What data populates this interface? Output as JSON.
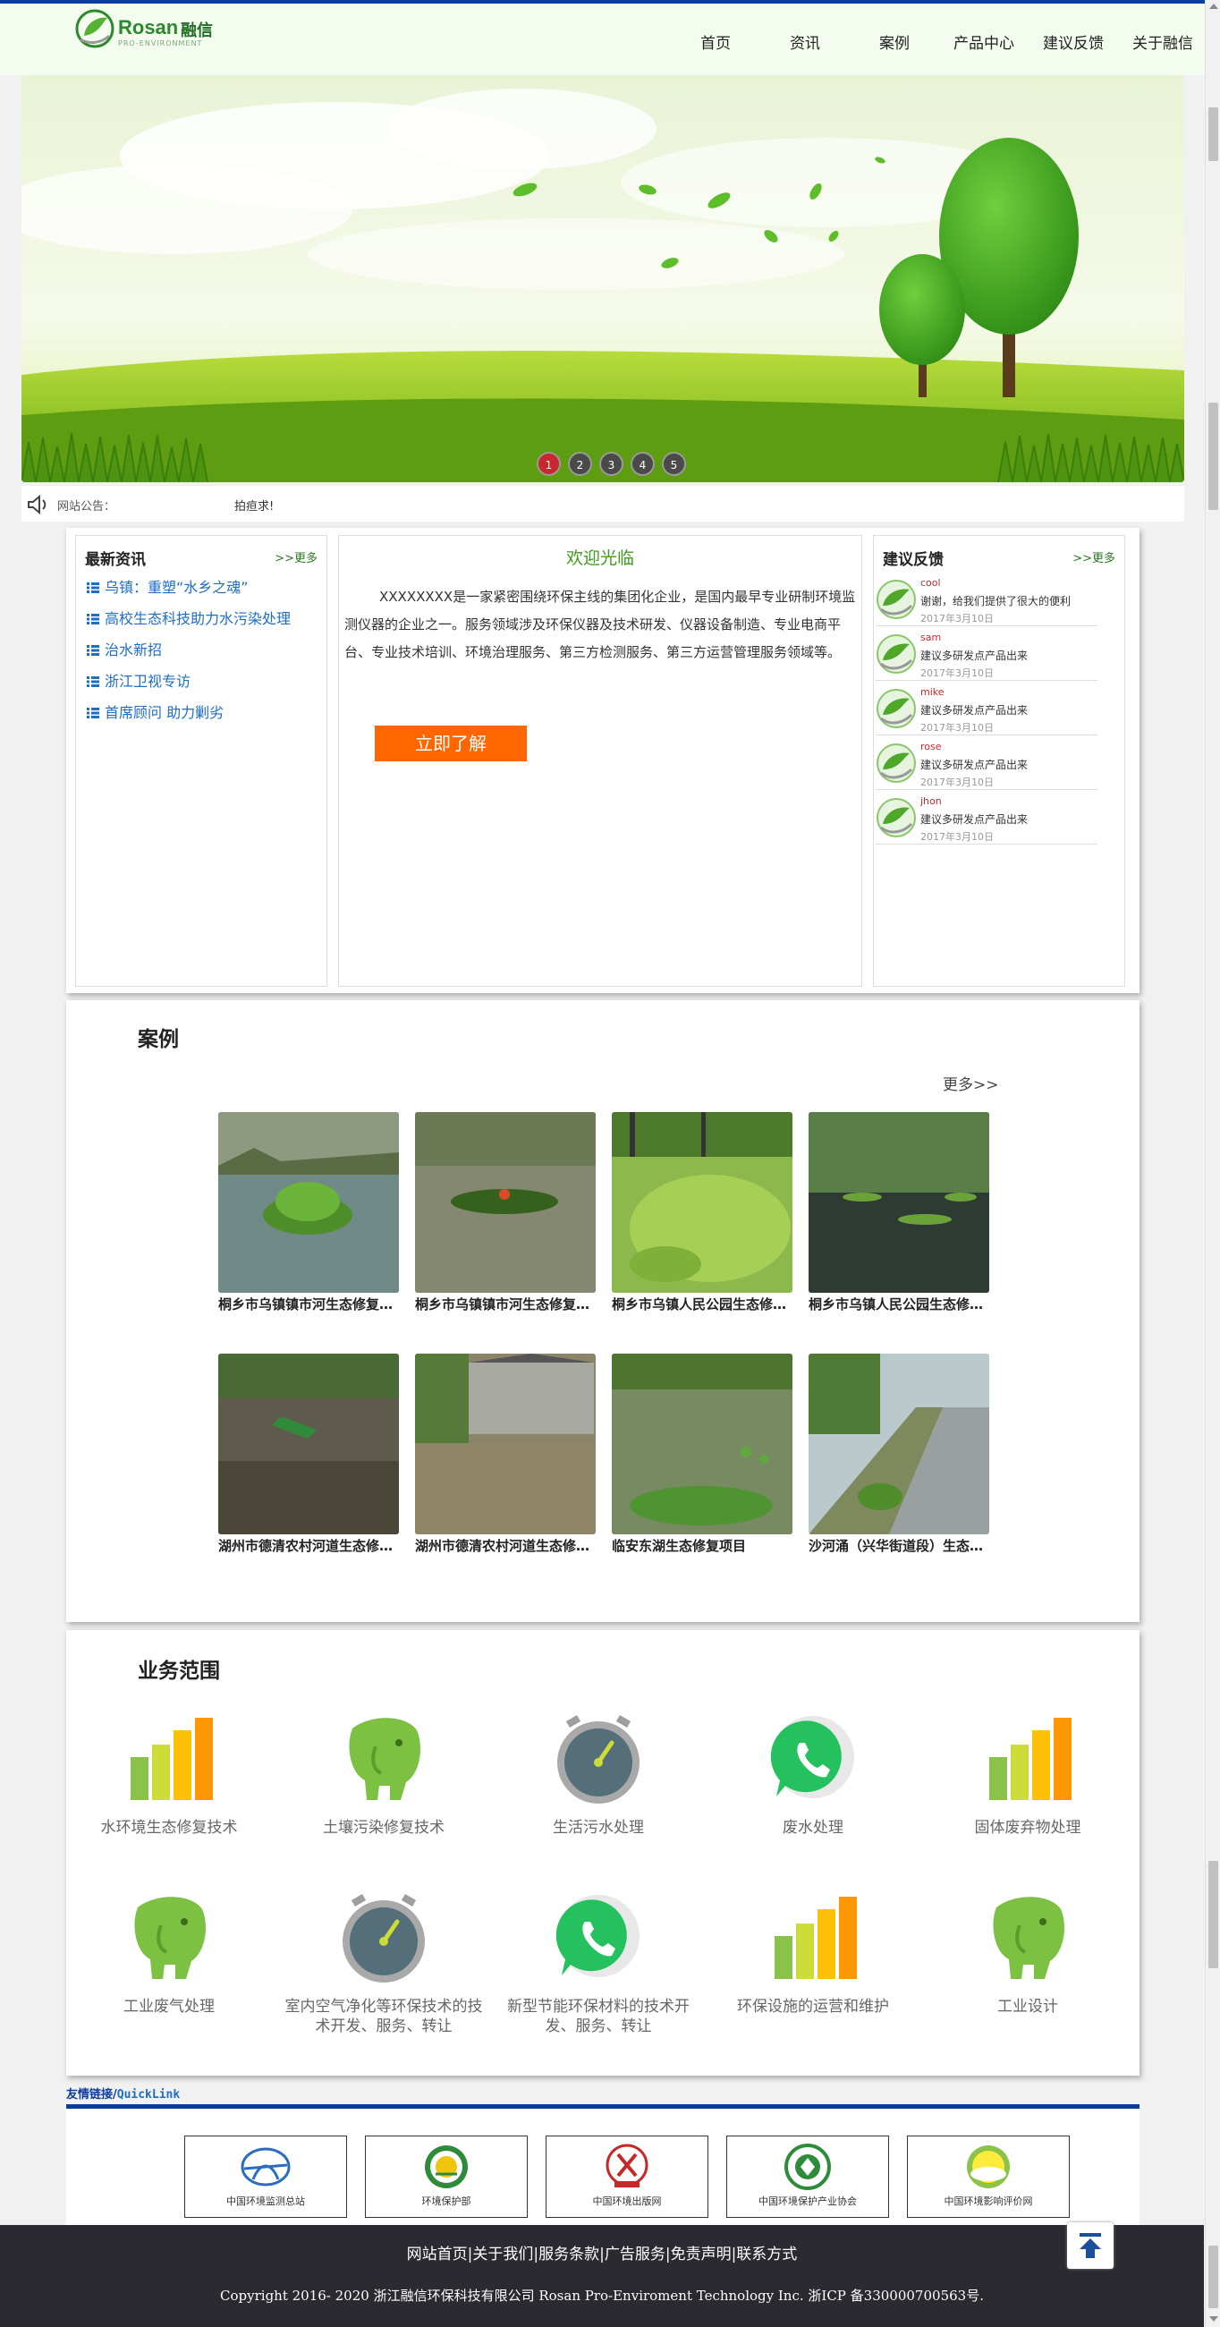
{
  "header": {
    "logo_brand": "Rosan",
    "logo_cn": "融信",
    "logo_tag": "PRO-ENVIRONMENT",
    "nav": [
      "首页",
      "资讯",
      "案例",
      "产品中心",
      "建议反馈",
      "关于融信"
    ]
  },
  "banner": {
    "dots": [
      "1",
      "2",
      "3",
      "4",
      "5"
    ],
    "active": "1"
  },
  "notice": {
    "label": "网站公告：",
    "text": "拍疸求!"
  },
  "news": {
    "title": "最新资讯",
    "more": ">>更多",
    "items": [
      "乌镇：重塑“水乡之魂”",
      "高校生态科技助力水污染处理",
      "治水新招",
      "浙江卫视专访",
      "首席顾问 助力剿劣"
    ]
  },
  "welcome": {
    "title": "欢迎光临",
    "text": "XXXXXXXX是一家紧密围绕环保主线的集团化企业，是国内最早专业研制环境监测仪器的企业之一。服务领域涉及环保仪器及技术研发、仪器设备制造、专业电商平台、专业技术培训、环境治理服务、第三方检测服务、第三方运营管理服务领域等。",
    "button": "立即了解"
  },
  "feedback": {
    "title": "建议反馈",
    "more": ">>更多",
    "items": [
      {
        "name": "cool",
        "msg": "谢谢，给我们提供了很大的便利",
        "date": "2017年3月10日"
      },
      {
        "name": "sam",
        "msg": "建议多研发点产品出来",
        "date": "2017年3月10日"
      },
      {
        "name": "mike",
        "msg": "建议多研发点产品出来",
        "date": "2017年3月10日"
      },
      {
        "name": "rose",
        "msg": "建议多研发点产品出来",
        "date": "2017年3月10日"
      },
      {
        "name": "jhon",
        "msg": "建议多研发点产品出来",
        "date": "2017年3月10日"
      }
    ]
  },
  "cases": {
    "title": "案例",
    "more": "更多>>",
    "items": [
      "桐乡市乌镇镇市河生态修复项目",
      "桐乡市乌镇镇市河生态修复项目",
      "桐乡市乌镇人民公园生态修复项目",
      "桐乡市乌镇人民公园生态修复项目",
      "湖州市德清农村河道生态修复项目",
      "湖州市德清农村河道生态修复项目",
      "临安东湖生态修复项目",
      "沙河涌（兴华街道段）生态修复项目"
    ]
  },
  "business": {
    "title": "业务范围",
    "items": [
      {
        "label": "水环境生态修复技术",
        "icon": "bar-chart-icon"
      },
      {
        "label": "土壤污染修复技术",
        "icon": "elephant-icon"
      },
      {
        "label": "生活污水处理",
        "icon": "stopwatch-icon"
      },
      {
        "label": "废水处理",
        "icon": "whatsapp-icon"
      },
      {
        "label": "固体废弃物处理",
        "icon": "bar-chart-icon"
      },
      {
        "label": "工业废气处理",
        "icon": "elephant-icon"
      },
      {
        "label": "室内空气净化等环保技术的技术开发、服务、转让",
        "icon": "stopwatch-icon"
      },
      {
        "label": "新型节能环保材料的技术开发、服务、转让",
        "icon": "whatsapp-icon"
      },
      {
        "label": "环保设施的运营和维护",
        "icon": "bar-chart-icon"
      },
      {
        "label": "工业设计",
        "icon": "elephant-icon"
      }
    ]
  },
  "links": {
    "title_cn": "友情链接/",
    "title_en": "QuickLink",
    "items": [
      "中国环境监测总站",
      "环境保护部",
      "中国环境出版网",
      "中国环境保护产业协会",
      "中国环境影响评价网"
    ]
  },
  "footer": {
    "links": "网站首页|关于我们|服务条款|广告服务|免责声明|联系方式",
    "copyright": "Copyright 2016- 2020 浙江融信环保科技有限公司 Rosan Pro-Enviroment Technology Inc. 浙ICP 备330000700563号."
  },
  "colors": {
    "accent_green": "#3f9b1d",
    "link_blue": "#1e6ec4",
    "button_orange": "#ff6600",
    "nav_blue": "#0b3c9c",
    "footer_bg": "#2a2a30"
  }
}
